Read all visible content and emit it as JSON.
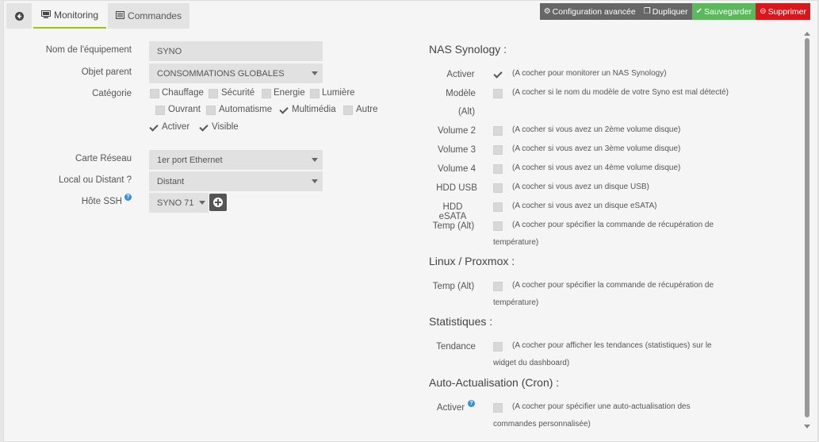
{
  "tabs": {
    "back_icon": "arrow-circle-left-icon",
    "monitoring": "Monitoring",
    "commandes": "Commandes"
  },
  "actions": {
    "config": "Configuration avancée",
    "duplicate": "Dupliquer",
    "save": "Sauvegarder",
    "delete": "Supprimer"
  },
  "colors": {
    "accent": "#94ca02",
    "save": "#5cb85c",
    "delete": "#d9161b",
    "dark": "#666666"
  },
  "left": {
    "name_label": "Nom de l'équipement",
    "name_value": "SYNO",
    "parent_label": "Objet parent",
    "parent_value": "CONSOMMATIONS GLOBALES",
    "category_label": "Catégorie",
    "categories": [
      {
        "label": "Chauffage",
        "checked": false
      },
      {
        "label": "Sécurité",
        "checked": false
      },
      {
        "label": "Energie",
        "checked": false
      },
      {
        "label": "Lumière",
        "checked": false
      },
      {
        "label": "Ouvrant",
        "checked": false
      },
      {
        "label": "Automatisme",
        "checked": false
      },
      {
        "label": "Multimédia",
        "checked": true
      },
      {
        "label": "Autre",
        "checked": false
      }
    ],
    "activer": "Activer",
    "visible": "Visible",
    "network_label": "Carte Réseau",
    "network_value": "1er port Ethernet",
    "local_label": "Local ou Distant ?",
    "local_value": "Distant",
    "ssh_label": "Hôte SSH",
    "ssh_value": "SYNO 71"
  },
  "right": {
    "nas_title": "NAS Synology :",
    "activer": "Activer",
    "activer_note": "(A cocher pour monitorer un NAS Synology)",
    "modele_1": "Modèle",
    "modele_2": "(Alt)",
    "modele_note": "(A cocher si le nom du modèle de votre Syno est mal détecté)",
    "vol2": "Volume 2",
    "vol2_note": "(A cocher si vous avez un 2ème volume disque)",
    "vol3": "Volume 3",
    "vol3_note": "(A cocher si vous avez un 3ème volume disque)",
    "vol4": "Volume 4",
    "vol4_note": "(A cocher si vous avez un 4ème volume disque)",
    "hddusb": "HDD USB",
    "hddusb_note": "(A cocher si vous avez un disque USB)",
    "hddesata": "HDD eSATA",
    "hddesata_note": "(A cocher si vous avez un disque eSATA)",
    "temp": "Temp (Alt)",
    "temp_note_1": "(A cocher pour spécifier la commande de récupération de",
    "temp_note_2": "température)",
    "linux_title": "Linux / Proxmox :",
    "ltemp": "Temp (Alt)",
    "ltemp_note_1": "(A cocher pour spécifier la commande de récupération de",
    "ltemp_note_2": "température)",
    "stats_title": "Statistiques :",
    "tendance": "Tendance",
    "tendance_note_1": "(A cocher pour afficher les tendances (statistiques) sur le",
    "tendance_note_2": "widget du dashboard)",
    "auto_title": "Auto-Actualisation (Cron) :",
    "auto_activer": "Activer",
    "auto_note_1": "(A cocher pour spécifier une auto-actualisation des",
    "auto_note_2": "commandes personnalisée)"
  }
}
